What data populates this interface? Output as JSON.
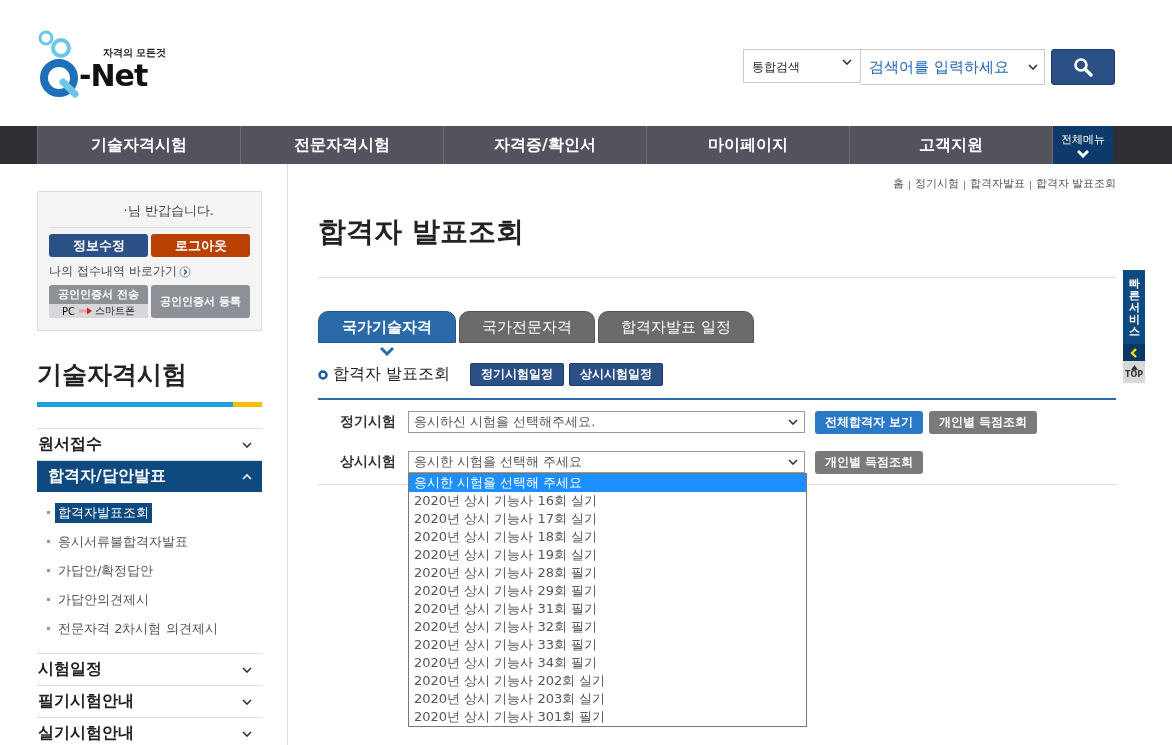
{
  "logo": {
    "tagline": "자격의 모든것",
    "name": "-Net"
  },
  "search": {
    "scope": "통합검색",
    "placeholder": "검색어를 입력하세요"
  },
  "nav": {
    "items": [
      "기술자격시험",
      "전문자격시험",
      "자격증/확인서",
      "마이페이지",
      "고객지원"
    ],
    "all_menu": "전체메뉴"
  },
  "user_box": {
    "greeting": "·님 반갑습니다.",
    "buttons": [
      {
        "label": "정보수정",
        "kind": "primary"
      },
      {
        "label": "로그아웃",
        "kind": "danger"
      }
    ],
    "receipt_link": "나의 접수내역 바로가기",
    "cert_send": {
      "label": "공인인증서 전송",
      "from": "PC",
      "to": "스마트폰"
    },
    "cert_register": "공인인증서 등록"
  },
  "sidebar": {
    "title": "기술자격시험",
    "items": [
      {
        "label": "원서접수",
        "expanded": false
      },
      {
        "label": "합격자/답안발표",
        "expanded": true,
        "children": [
          {
            "label": "합격자발표조회",
            "selected": true
          },
          {
            "label": "응시서류불합격자발표",
            "selected": false
          },
          {
            "label": "가답안/확정답안",
            "selected": false
          },
          {
            "label": "가답안의견제시",
            "selected": false
          },
          {
            "label": "전문자격 2차시험 의견제시",
            "selected": false
          }
        ]
      },
      {
        "label": "시험일정",
        "expanded": false
      },
      {
        "label": "필기시험안내",
        "expanded": false
      },
      {
        "label": "실기시험안내",
        "expanded": false
      }
    ]
  },
  "breadcrumb": [
    "홈",
    "정기시험",
    "합격자발표",
    "합격자 발표조회"
  ],
  "page_title": "합격자 발표조회",
  "tabs": [
    {
      "label": "국가기술자격",
      "selected": true
    },
    {
      "label": "국가전문자격",
      "selected": false
    },
    {
      "label": "합격자발표 일정",
      "selected": false
    }
  ],
  "section": {
    "title": "합격자 발표조회",
    "buttons": [
      "정기시험일정",
      "상시시험일정"
    ]
  },
  "form_rows": [
    {
      "label": "정기시험",
      "value": "응시하신 시험을 선택해주세요.",
      "buttons": [
        {
          "label": "전체합격자 보기",
          "kind": "primary"
        },
        {
          "label": "개인별 득점조회",
          "kind": "secondary"
        }
      ]
    },
    {
      "label": "상시시험",
      "value": "응시한 시험을 선택해 주세요",
      "buttons": [
        {
          "label": "개인별 득점조회",
          "kind": "secondary"
        }
      ]
    }
  ],
  "dropdown": {
    "options": [
      {
        "label": "응시한 시험을 선택해 주세요",
        "selected": true
      },
      {
        "label": "2020년 상시 기능사 16회 실기",
        "selected": false
      },
      {
        "label": "2020년 상시 기능사 17회 실기",
        "selected": false
      },
      {
        "label": "2020년 상시 기능사 18회 실기",
        "selected": false
      },
      {
        "label": "2020년 상시 기능사 19회 실기",
        "selected": false
      },
      {
        "label": "2020년 상시 기능사 28회 필기",
        "selected": false
      },
      {
        "label": "2020년 상시 기능사 29회 필기",
        "selected": false
      },
      {
        "label": "2020년 상시 기능사 31회 필기",
        "selected": false
      },
      {
        "label": "2020년 상시 기능사 32회 필기",
        "selected": false
      },
      {
        "label": "2020년 상시 기능사 33회 필기",
        "selected": false
      },
      {
        "label": "2020년 상시 기능사 34회 필기",
        "selected": false
      },
      {
        "label": "2020년 상시 기능사 202회 실기",
        "selected": false
      },
      {
        "label": "2020년 상시 기능사 203회 실기",
        "selected": false
      },
      {
        "label": "2020년 상시 기능사 301회 필기",
        "selected": false
      }
    ]
  },
  "quick_service": {
    "label": "빠른서비스",
    "top": "TOP"
  }
}
